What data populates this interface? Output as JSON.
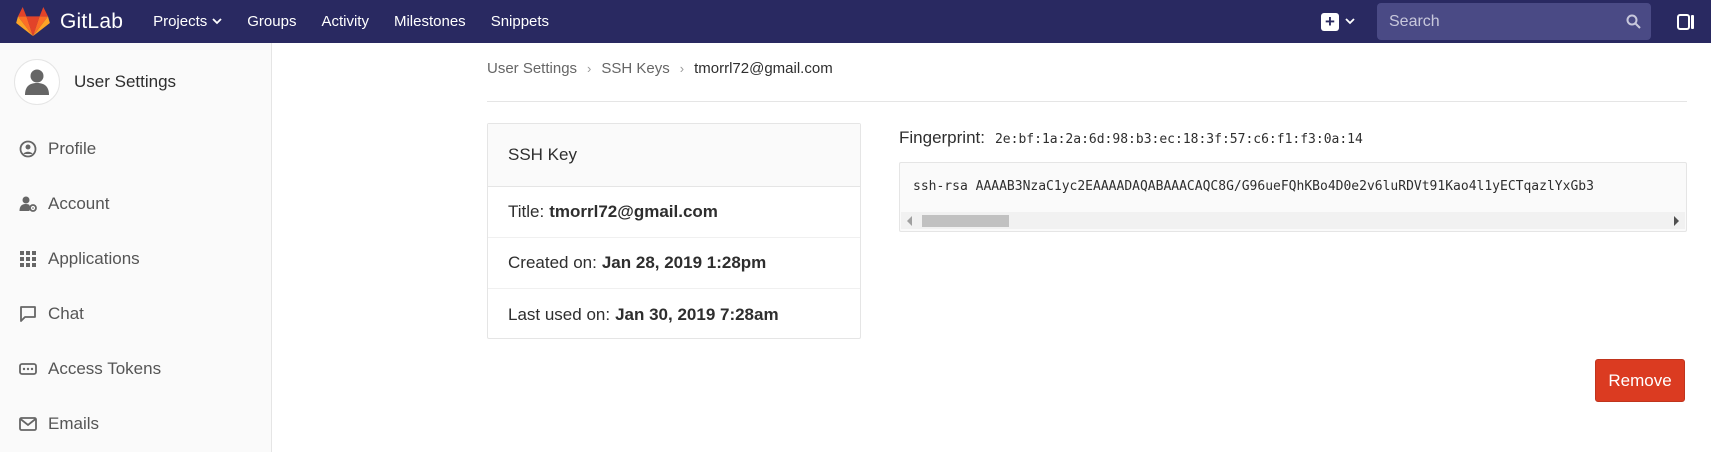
{
  "navbar": {
    "brand": "GitLab",
    "links": [
      "Projects",
      "Groups",
      "Activity",
      "Milestones",
      "Snippets"
    ],
    "search_placeholder": "Search"
  },
  "sidebar": {
    "title": "User Settings",
    "items": [
      {
        "label": "Profile",
        "icon": "profile-icon"
      },
      {
        "label": "Account",
        "icon": "account-icon"
      },
      {
        "label": "Applications",
        "icon": "applications-icon"
      },
      {
        "label": "Chat",
        "icon": "chat-icon"
      },
      {
        "label": "Access Tokens",
        "icon": "access-tokens-icon"
      },
      {
        "label": "Emails",
        "icon": "emails-icon"
      }
    ]
  },
  "breadcrumb": {
    "items": [
      "User Settings",
      "SSH Keys"
    ],
    "current": "tmorrl72@gmail.com"
  },
  "card": {
    "header": "SSH Key",
    "title_label": "Title:",
    "title_value": "tmorrl72@gmail.com",
    "created_label": "Created on:",
    "created_value": "Jan 28, 2019 1:28pm",
    "last_used_label": "Last used on:",
    "last_used_value": "Jan 30, 2019 7:28am"
  },
  "fingerprint": {
    "label": "Fingerprint:",
    "value": "2e:bf:1a:2a:6d:98:b3:ec:18:3f:57:c6:f1:f3:0a:14"
  },
  "key": {
    "text": "ssh-rsa AAAAB3NzaC1yc2EAAAADAQABAAACAQC8G/G96ueFQhKBo4D0e2v6luRDVt91Kao4l1yECTqazlYxGb3"
  },
  "actions": {
    "remove_label": "Remove"
  },
  "colors": {
    "navbar": "#292961",
    "remove": "#db3b21"
  }
}
